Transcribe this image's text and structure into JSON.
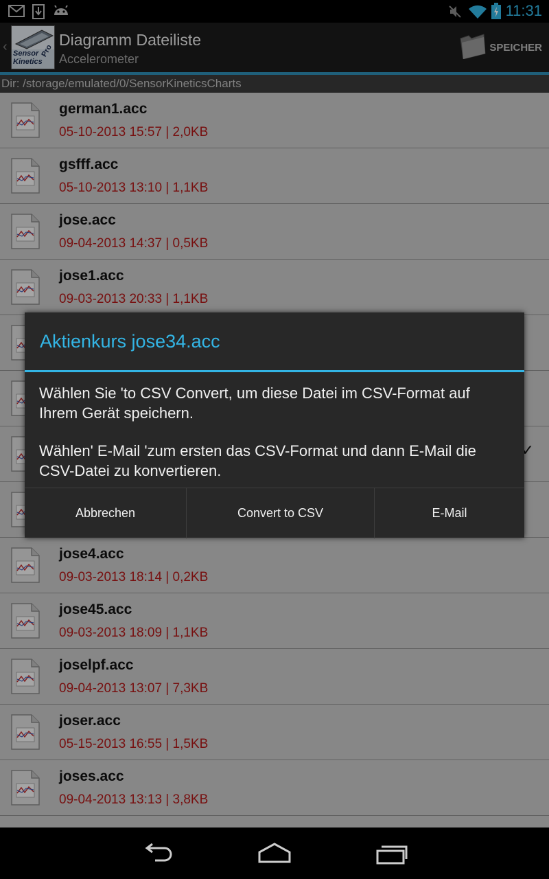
{
  "status_bar": {
    "time": "11:31",
    "icons": [
      "gmail-icon",
      "download-icon",
      "android-icon",
      "mute-icon",
      "wifi-icon",
      "battery-charging-icon"
    ]
  },
  "action_bar": {
    "title": "Diagramm Dateiliste",
    "subtitle": "Accelerometer",
    "app_logo_text": "Sensor Kinetics",
    "app_logo_badge": "Pro",
    "save_label": "SPEICHER"
  },
  "directory": "Dir: /storage/emulated/0/SensorKineticsCharts",
  "files": [
    {
      "name": "german1.acc",
      "meta": "05-10-2013 15:57 | 2,0KB"
    },
    {
      "name": "gsfff.acc",
      "meta": "05-10-2013 13:10 | 1,1KB"
    },
    {
      "name": "jose.acc",
      "meta": "09-04-2013 14:37 | 0,5KB"
    },
    {
      "name": "jose1.acc",
      "meta": "09-03-2013 20:33 | 1,1KB"
    },
    {
      "name": "",
      "meta": ""
    },
    {
      "name": "",
      "meta": ""
    },
    {
      "name": "",
      "meta": "",
      "checked": true
    },
    {
      "name": "",
      "meta": ""
    },
    {
      "name": "jose4.acc",
      "meta": "09-03-2013 18:14 | 0,2KB"
    },
    {
      "name": "jose45.acc",
      "meta": "09-03-2013 18:09 | 1,1KB"
    },
    {
      "name": "joselpf.acc",
      "meta": "09-04-2013 13:07 | 7,3KB"
    },
    {
      "name": "joser.acc",
      "meta": "05-15-2013 16:55 | 1,5KB"
    },
    {
      "name": "joses.acc",
      "meta": "09-04-2013 13:13 | 3,8KB"
    }
  ],
  "dialog": {
    "title": "Aktienkurs jose34.acc",
    "message_1": "Wählen Sie 'to CSV Convert, um diese Datei im CSV-Format auf Ihrem Gerät speichern.",
    "message_2": "Wählen' E-Mail 'zum ersten das CSV-Format und dann E-Mail die CSV-Datei zu konvertieren.",
    "buttons": {
      "cancel": "Abbrechen",
      "convert": "Convert to CSV",
      "email": "E-Mail"
    }
  },
  "colors": {
    "accent": "#33b5e5",
    "file_meta": "#b01818",
    "list_bg": "#c7c7c7",
    "dialog_bg": "#282828"
  }
}
